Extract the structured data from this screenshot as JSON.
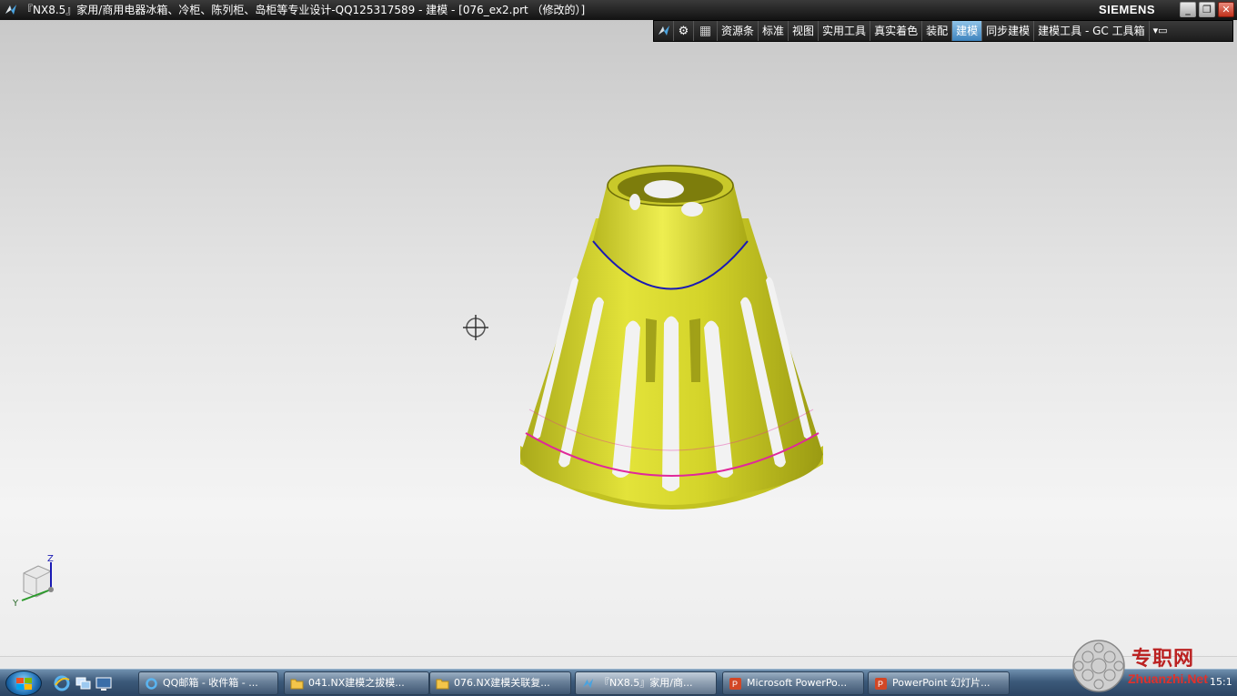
{
  "window": {
    "title": "『NX8.5』家用/商用电器冰箱、冷柜、陈列柜、岛柜等专业设计-QQ125317589 - 建模 - [076_ex2.prt （修改的）]",
    "brand": "SIEMENS",
    "min_label": "_",
    "max_label": "❐",
    "close_label": "✕"
  },
  "ribbon": {
    "tabs": [
      {
        "label": "资源条"
      },
      {
        "label": "标准"
      },
      {
        "label": "视图"
      },
      {
        "label": "实用工具"
      },
      {
        "label": "真实着色"
      },
      {
        "label": "装配"
      },
      {
        "label": "建模",
        "active": true
      },
      {
        "label": "同步建模"
      },
      {
        "label": "建模工具 - GC 工具箱"
      }
    ],
    "icons": [
      "nx-logo-icon",
      "gear-icon",
      "grid-icon",
      "ribbon-menu-icon"
    ]
  },
  "viewport": {
    "triad_labels": {
      "z": "Z",
      "y": "Y"
    },
    "colors": {
      "part_fill": "#d6d62a",
      "part_dark": "#8f8f10",
      "edge_blue": "#1a1ab4",
      "edge_magenta": "#e0289a"
    }
  },
  "taskbar": {
    "tasks": [
      {
        "label": "QQ邮箱 - 收件箱 - ...",
        "icon": "ie-icon"
      },
      {
        "label": "041.NX建模之拔模...",
        "icon": "folder-icon"
      },
      {
        "label": "076.NX建模关联复...",
        "icon": "folder-icon"
      },
      {
        "label": "『NX8.5』家用/商...",
        "icon": "nx-icon",
        "active": true
      },
      {
        "label": "Microsoft PowerPo...",
        "icon": "powerpoint-icon"
      },
      {
        "label": "PowerPoint 幻灯片...",
        "icon": "powerpoint-icon"
      }
    ],
    "clock": "15:1"
  },
  "watermark": {
    "text_cn": "专职网",
    "text_en": "Zhuanzhi.Net"
  }
}
